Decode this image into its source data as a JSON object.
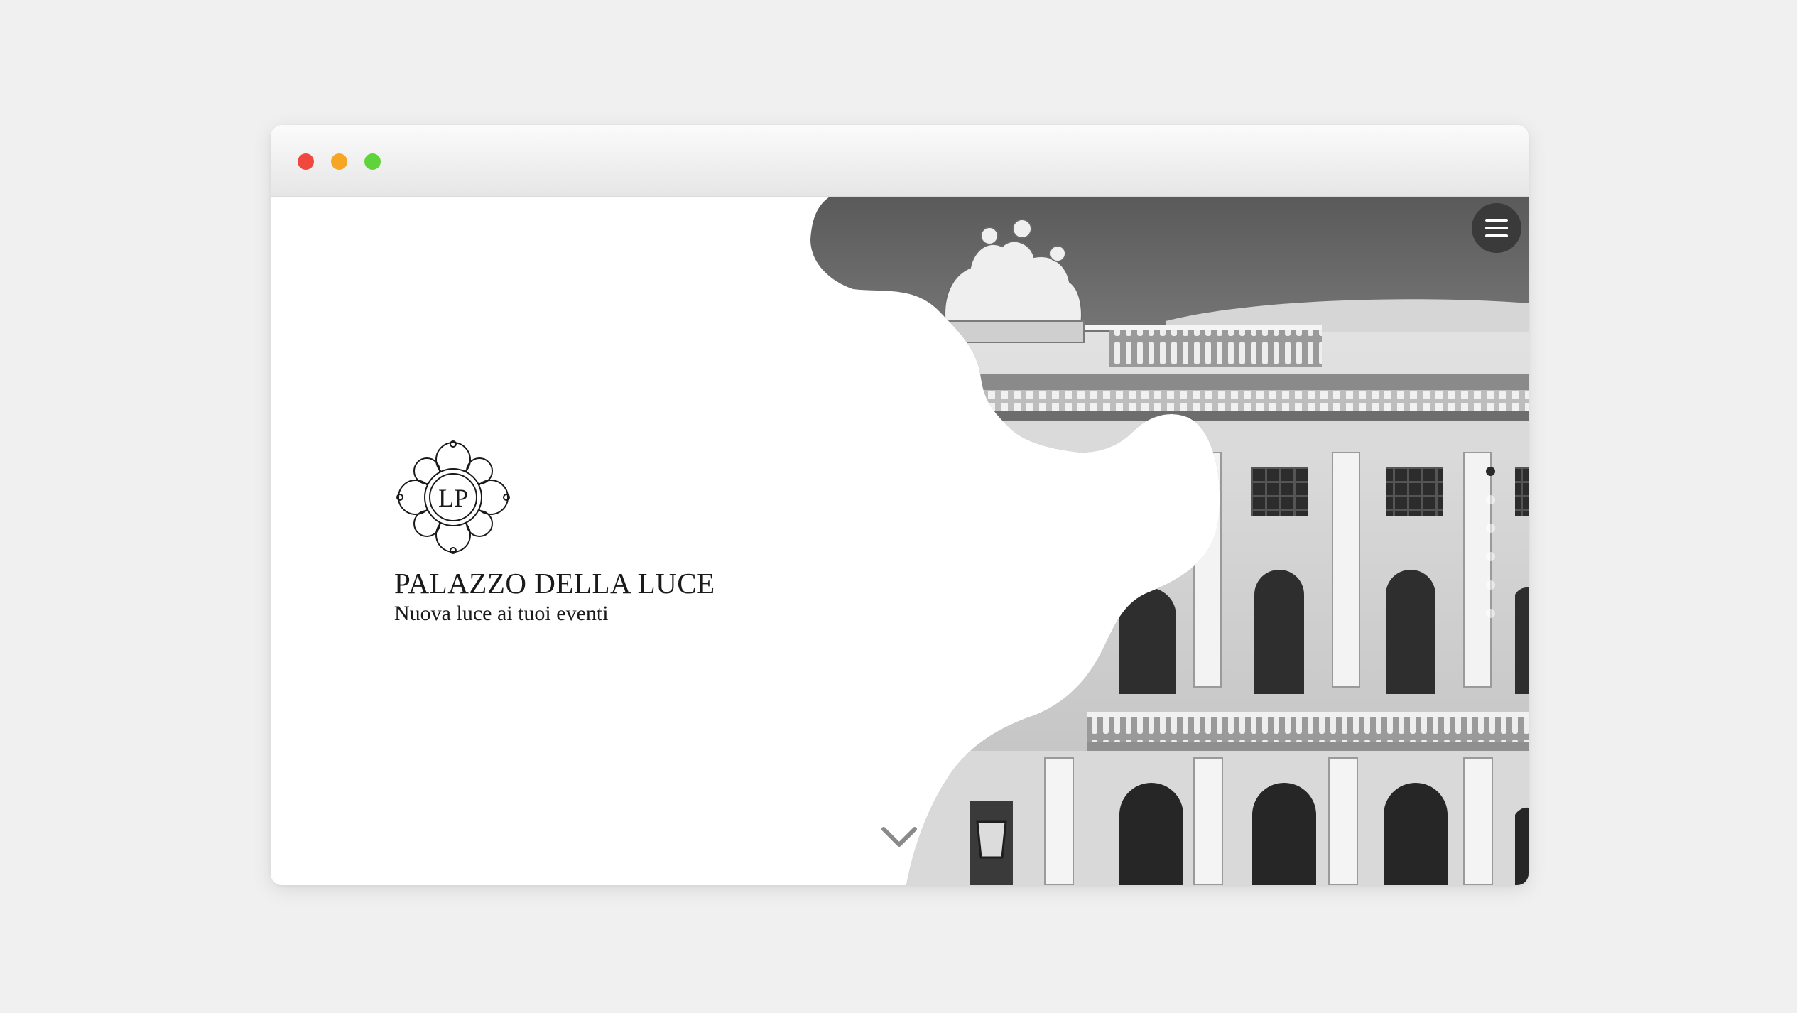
{
  "window": {
    "controls": [
      "close",
      "minimize",
      "maximize"
    ]
  },
  "brand": {
    "monogram": "LP",
    "name": "PALAZZO DELLA LUCE",
    "tagline": "Nuova luce ai tuoi eventi"
  },
  "hero": {
    "image": "black-and-white photo of a neoclassical palazzo facade with statue group on the roofline",
    "pager": {
      "count": 6,
      "active_index": 0
    }
  },
  "icons": {
    "menu": "hamburger-menu-icon",
    "scroll": "chevron-down-icon",
    "logo": "floral-monogram-emblem"
  },
  "colors": {
    "menu_button": "#3a3a3a",
    "text": "#1a1a1a",
    "chevron": "#8a8a8a"
  }
}
